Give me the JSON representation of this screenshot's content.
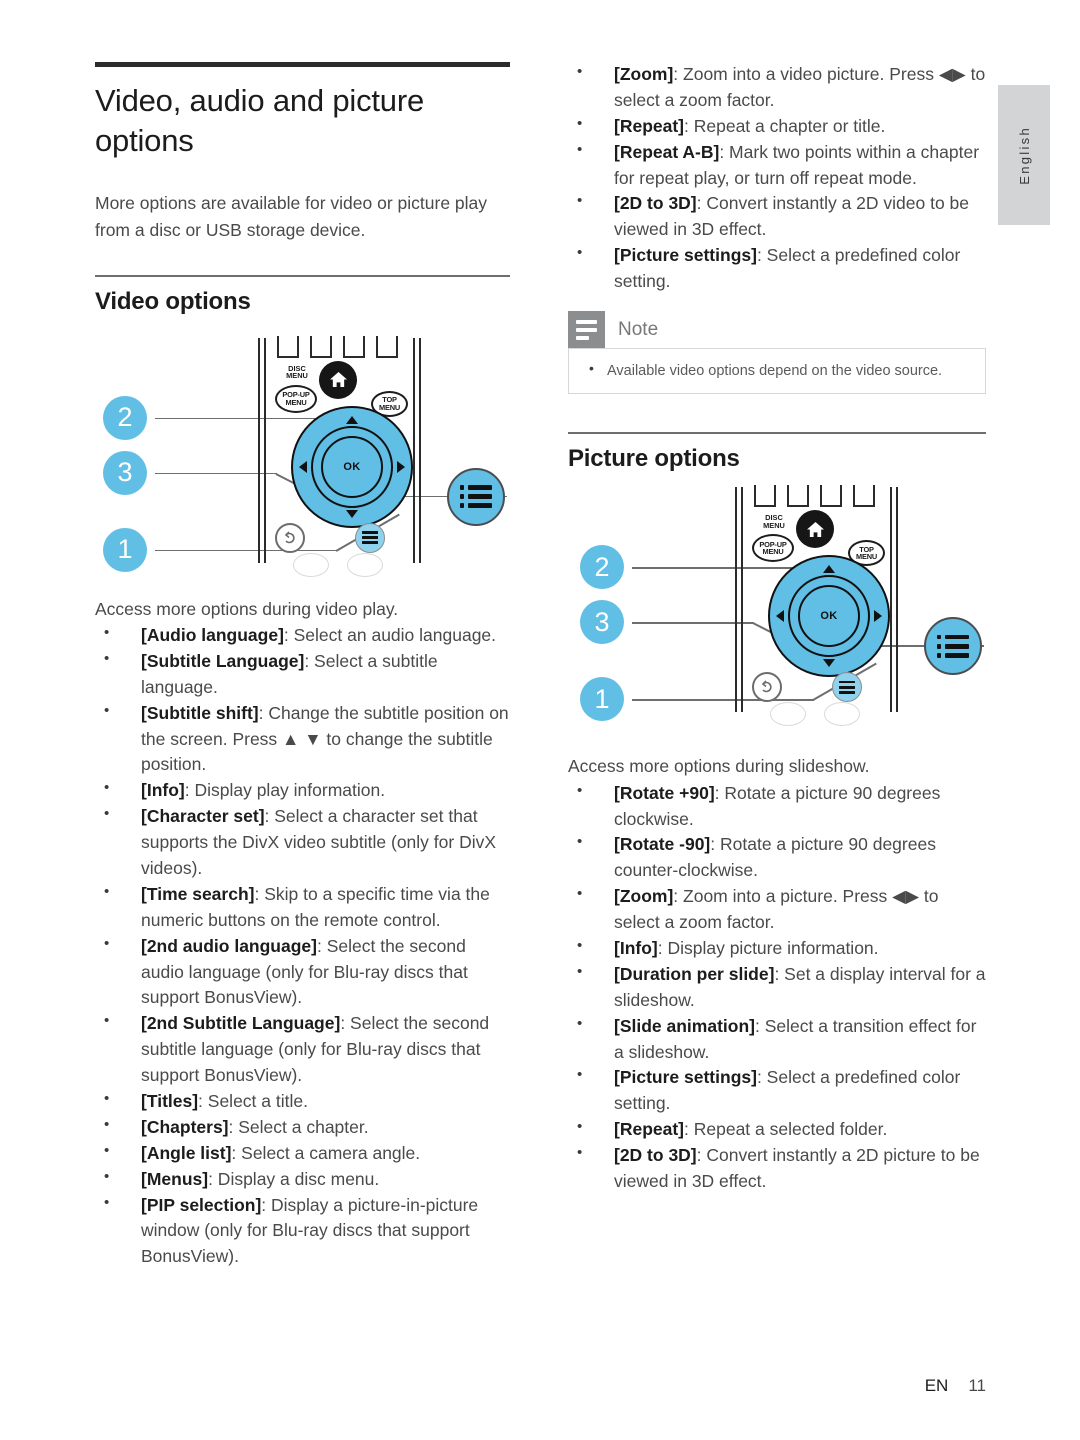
{
  "sidetab": {
    "language": "English"
  },
  "footer": {
    "locale": "EN",
    "page_number": "11"
  },
  "left": {
    "chapter_title": "Video, audio and picture options",
    "intro": "More options are available for video or picture play from a disc or USB storage device.",
    "section_title": "Video options",
    "figure": {
      "callouts": [
        "2",
        "3",
        "1"
      ],
      "buttons": {
        "disc_menu": "DISC MENU",
        "popup_menu": "POP-UP MENU",
        "top_menu": "TOP MENU",
        "ok": "OK"
      }
    },
    "lead": "Access more options during video play.",
    "options": [
      {
        "term": "[Audio language]",
        "desc": ": Select an audio language."
      },
      {
        "term": "[Subtitle Language]",
        "desc": ": Select a subtitle language."
      },
      {
        "term": "[Subtitle shift]",
        "desc": ": Change the subtitle position on the screen. Press ▲ ▼ to change the subtitle position."
      },
      {
        "term": "[Info]",
        "desc": ": Display play information."
      },
      {
        "term": "[Character set]",
        "desc": ": Select a character set that supports the DivX video subtitle (only for DivX videos)."
      },
      {
        "term": "[Time search]",
        "desc": ": Skip to a specific time via the numeric buttons on the remote control."
      },
      {
        "term": "[2nd audio language]",
        "desc": ": Select the second audio language (only for Blu-ray discs that support BonusView)."
      },
      {
        "term": "[2nd Subtitle Language]",
        "desc": ": Select the second subtitle language (only for Blu-ray discs that support BonusView)."
      },
      {
        "term": "[Titles]",
        "desc": ": Select a title."
      },
      {
        "term": "[Chapters]",
        "desc": ": Select a chapter."
      },
      {
        "term": "[Angle list]",
        "desc": ": Select a camera angle."
      },
      {
        "term": "[Menus]",
        "desc": ": Display a disc menu."
      },
      {
        "term": "[PIP selection]",
        "desc": ": Display a picture-in-picture window (only for Blu-ray discs that support BonusView)."
      }
    ]
  },
  "right": {
    "video_options_continued": [
      {
        "term": "[Zoom]",
        "desc": ": Zoom into a video picture. Press ◀▶ to select a zoom factor."
      },
      {
        "term": "[Repeat]",
        "desc": ": Repeat a chapter or title."
      },
      {
        "term": "[Repeat A-B]",
        "desc": ": Mark two points within a chapter for repeat play, or turn off repeat mode."
      },
      {
        "term": "[2D to 3D]",
        "desc": ": Convert instantly a 2D video to be viewed in 3D effect."
      },
      {
        "term": "[Picture settings]",
        "desc": ": Select a predefined color setting."
      }
    ],
    "note": {
      "label": "Note",
      "items": [
        "Available video options depend on the video source."
      ]
    },
    "section_title": "Picture options",
    "figure": {
      "callouts": [
        "2",
        "3",
        "1"
      ],
      "buttons": {
        "disc_menu": "DISC MENU",
        "popup_menu": "POP-UP MENU",
        "top_menu": "TOP MENU",
        "ok": "OK"
      }
    },
    "lead": "Access more options during slideshow.",
    "options": [
      {
        "term": "[Rotate +90]",
        "desc": ": Rotate a picture 90 degrees clockwise."
      },
      {
        "term": "[Rotate -90]",
        "desc": ": Rotate a picture 90 degrees counter-clockwise."
      },
      {
        "term": "[Zoom]",
        "desc": ": Zoom into a picture. Press ◀▶ to select a zoom factor."
      },
      {
        "term": "[Info]",
        "desc": ": Display picture information."
      },
      {
        "term": "[Duration per slide]",
        "desc": ": Set a display interval for a slideshow."
      },
      {
        "term": "[Slide animation]",
        "desc": ": Select a transition effect for a slideshow."
      },
      {
        "term": "[Picture settings]",
        "desc": ": Select a predefined color setting."
      },
      {
        "term": "[Repeat]",
        "desc": ": Repeat a selected folder."
      },
      {
        "term": "[2D to 3D]",
        "desc": ": Convert instantly a 2D picture to be viewed in 3D effect."
      }
    ]
  },
  "colors": {
    "accent_blue": "#61bee5",
    "tab_gray": "#d2d4d6",
    "note_gray": "#8b8d8f",
    "text_body": "#4a4a4a",
    "text_strong": "#1c1c1c"
  }
}
